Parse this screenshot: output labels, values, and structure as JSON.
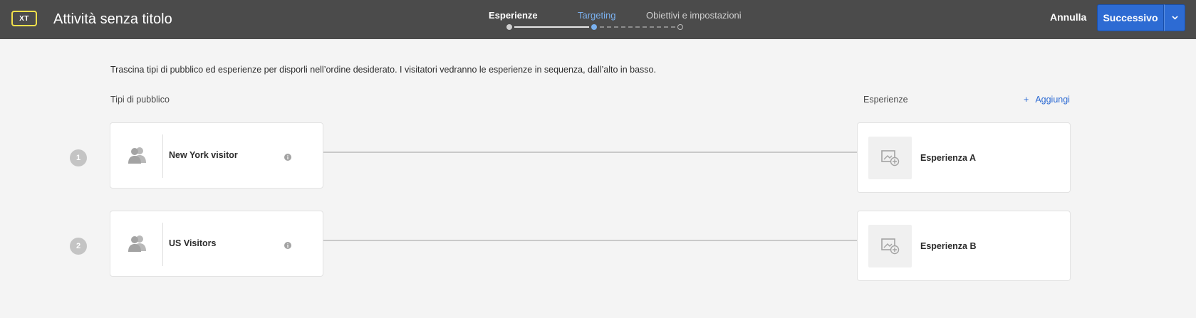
{
  "header": {
    "badge": "XT",
    "title": "Attività senza titolo",
    "steps": [
      {
        "label": "Esperienze",
        "state": "done"
      },
      {
        "label": "Targeting",
        "state": "active"
      },
      {
        "label": "Obiettivi e impostazioni",
        "state": "pending"
      }
    ],
    "cancel_label": "Annulla",
    "next_label": "Successivo"
  },
  "main": {
    "instructions": "Trascina tipi di pubblico ed esperienze per disporli nell’ordine desiderato. I visitatori vedranno le esperienze in sequenza, dall’alto in basso.",
    "audiences_heading": "Tipi di pubblico",
    "experiences_heading": "Esperienze",
    "add_label": "Aggiungi",
    "rows": [
      {
        "number": "1",
        "audience": "New York visitor",
        "experience": "Esperienza A"
      },
      {
        "number": "2",
        "audience": "US Visitors",
        "experience": "Esperienza B"
      }
    ]
  },
  "icons": {
    "audience": "people-icon",
    "info": "info-icon",
    "experience": "image-add-icon",
    "caret": "chevron-down-icon"
  },
  "colors": {
    "header_bg": "#4b4b4b",
    "accent": "#2d6bd3",
    "active_step": "#7ab0ee",
    "badge_border": "#f3e14b"
  }
}
